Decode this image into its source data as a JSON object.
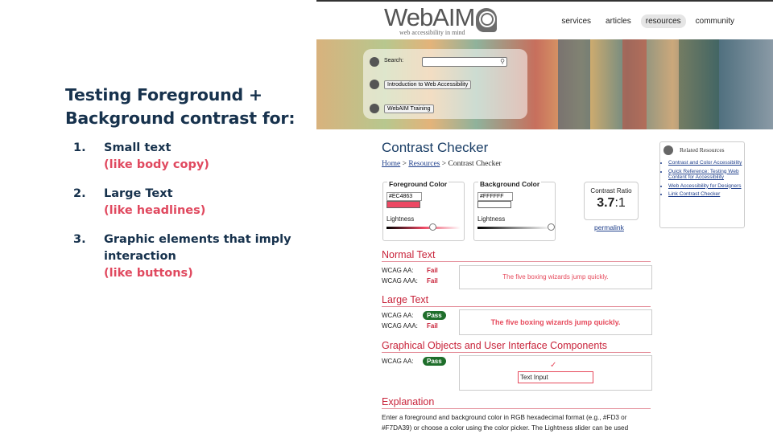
{
  "slide": {
    "title": "Testing Foreground + Background contrast for:",
    "items": [
      {
        "num": "1.",
        "text": "Small text",
        "sub": "(like body copy)"
      },
      {
        "num": "2.",
        "text": "Large Text",
        "sub": "(like headlines)"
      },
      {
        "num": "3.",
        "text": "Graphic elements that imply interaction",
        "sub": "(like buttons)"
      }
    ]
  },
  "site": {
    "logo_word": "WebAIM",
    "logo_tag": "web accessibility in mind",
    "nav": [
      "services",
      "articles",
      "resources",
      "community"
    ],
    "nav_active": "resources",
    "search_label": "Search:",
    "search_value": "",
    "banner_links": [
      "Introduction to Web Accessibility",
      "WebAIM Training"
    ]
  },
  "page": {
    "title": "Contrast Checker",
    "breadcrumb": {
      "home": "Home",
      "sep1": " > ",
      "resources": "Resources",
      "sep2": " > ",
      "current": "Contrast Checker"
    },
    "foreground": {
      "label": "Foreground Color",
      "hex": "#EC4863",
      "color": "#EC4863",
      "lightness_label": "Lightness"
    },
    "background": {
      "label": "Background Color",
      "hex": "#FFFFFF",
      "color": "#FFFFFF",
      "lightness_label": "Lightness"
    },
    "ratio": {
      "label": "Contrast Ratio",
      "value": "3.7",
      "suffix": ":1"
    },
    "permalink": "permalink",
    "related": {
      "heading": "Related Resources",
      "links": [
        "Contrast and Color Accessibility",
        "Quick Reference: Testing Web Content for Accessibility",
        "Web Accessibility for Designers",
        "Link Contrast Checker"
      ]
    },
    "normal_text": {
      "heading": "Normal Text",
      "aa_label": "WCAG AA:",
      "aa_status": "Fail",
      "aaa_label": "WCAG AAA:",
      "aaa_status": "Fail",
      "sample": "The five boxing wizards jump quickly."
    },
    "large_text": {
      "heading": "Large Text",
      "aa_label": "WCAG AA:",
      "aa_status": "Pass",
      "aaa_label": "WCAG AAA:",
      "aaa_status": "Fail",
      "sample": "The five boxing wizards jump quickly."
    },
    "graphical": {
      "heading": "Graphical Objects and User Interface Components",
      "aa_label": "WCAG AA:",
      "aa_status": "Pass",
      "check": "✓",
      "input_sample": "Text Input"
    },
    "explanation": {
      "heading": "Explanation",
      "text": "Enter a foreground and background color in RGB hexadecimal format (e.g., #FD3 or #F7DA39) or choose a color using the color picker. The Lightness slider can be used"
    }
  },
  "colors": {
    "navy": "#17324d",
    "accent": "#e0495f",
    "pass": "#1f6e2b"
  }
}
